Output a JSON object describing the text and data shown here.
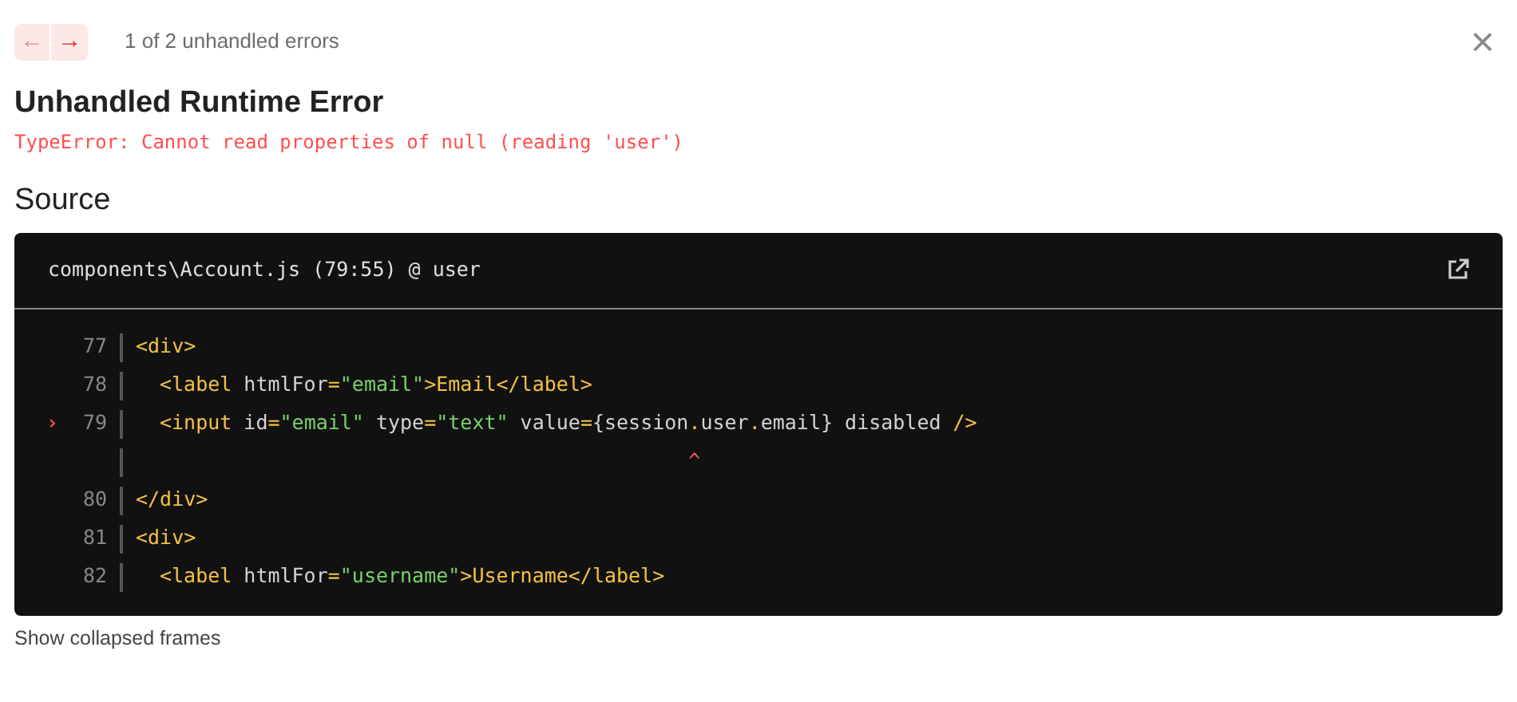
{
  "nav": {
    "prev": {
      "text": "←",
      "disabled": true
    },
    "next": {
      "text": "→",
      "disabled": false
    },
    "counter": "1 of 2 unhandled errors",
    "close": "×"
  },
  "error": {
    "title": "Unhandled Runtime Error",
    "message": "TypeError: Cannot read properties of null (reading 'user')"
  },
  "source": {
    "heading": "Source",
    "file": "components\\Account.js (79:55) @ user",
    "lines": [
      {
        "kind": "code",
        "number": "77",
        "indented": false,
        "segments": [
          {
            "kind": "tag",
            "text": "<div>"
          }
        ]
      },
      {
        "kind": "code",
        "number": "78",
        "indented": true,
        "segments": [
          {
            "kind": "tag",
            "text": "<label"
          },
          {
            "kind": "plain",
            "text": " htmlFor"
          },
          {
            "kind": "tag",
            "text": "="
          },
          {
            "kind": "string",
            "text": "\"email\""
          },
          {
            "kind": "tag",
            "text": ">Email</label>"
          }
        ]
      },
      {
        "kind": "code",
        "number": "79",
        "marker": "›",
        "indented": true,
        "segments": [
          {
            "kind": "tag",
            "text": "<input"
          },
          {
            "kind": "plain",
            "text": " id"
          },
          {
            "kind": "tag",
            "text": "="
          },
          {
            "kind": "string",
            "text": "\"email\""
          },
          {
            "kind": "plain",
            "text": " type"
          },
          {
            "kind": "tag",
            "text": "="
          },
          {
            "kind": "string",
            "text": "\"text\""
          },
          {
            "kind": "plain",
            "text": " value"
          },
          {
            "kind": "tag",
            "text": "="
          },
          {
            "kind": "plain",
            "text": "{session"
          },
          {
            "kind": "tag",
            "text": ".",
            "error": true
          },
          {
            "kind": "plain",
            "text": "user"
          },
          {
            "kind": "tag",
            "text": "."
          },
          {
            "kind": "plain",
            "text": "email} disabled "
          },
          {
            "kind": "tag",
            "text": "/>"
          }
        ]
      },
      {
        "kind": "caret",
        "caret": "^"
      },
      {
        "kind": "code",
        "number": "80",
        "indented": false,
        "segments": [
          {
            "kind": "tag",
            "text": "</div>"
          }
        ]
      },
      {
        "kind": "code",
        "number": "81",
        "indented": false,
        "segments": [
          {
            "kind": "tag",
            "text": "<div>"
          }
        ]
      },
      {
        "kind": "code",
        "number": "82",
        "indented": true,
        "segments": [
          {
            "kind": "tag",
            "text": "<label"
          },
          {
            "kind": "plain",
            "text": " htmlFor"
          },
          {
            "kind": "tag",
            "text": "="
          },
          {
            "kind": "string",
            "text": "\"username\""
          },
          {
            "kind": "tag",
            "text": ">Username</label>"
          }
        ]
      }
    ]
  },
  "footer": {
    "link": "Show collapsed frames"
  }
}
